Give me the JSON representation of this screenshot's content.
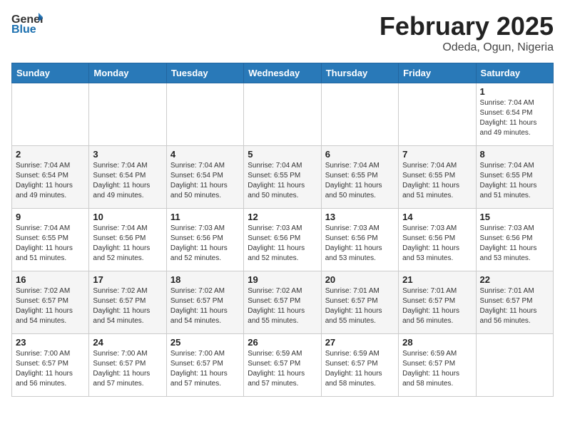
{
  "header": {
    "logo_general": "General",
    "logo_blue": "Blue",
    "title": "February 2025",
    "subtitle": "Odeda, Ogun, Nigeria"
  },
  "calendar": {
    "days_of_week": [
      "Sunday",
      "Monday",
      "Tuesday",
      "Wednesday",
      "Thursday",
      "Friday",
      "Saturday"
    ],
    "weeks": [
      [
        {
          "day": "",
          "info": ""
        },
        {
          "day": "",
          "info": ""
        },
        {
          "day": "",
          "info": ""
        },
        {
          "day": "",
          "info": ""
        },
        {
          "day": "",
          "info": ""
        },
        {
          "day": "",
          "info": ""
        },
        {
          "day": "1",
          "info": "Sunrise: 7:04 AM\nSunset: 6:54 PM\nDaylight: 11 hours\nand 49 minutes."
        }
      ],
      [
        {
          "day": "2",
          "info": "Sunrise: 7:04 AM\nSunset: 6:54 PM\nDaylight: 11 hours\nand 49 minutes."
        },
        {
          "day": "3",
          "info": "Sunrise: 7:04 AM\nSunset: 6:54 PM\nDaylight: 11 hours\nand 49 minutes."
        },
        {
          "day": "4",
          "info": "Sunrise: 7:04 AM\nSunset: 6:54 PM\nDaylight: 11 hours\nand 50 minutes."
        },
        {
          "day": "5",
          "info": "Sunrise: 7:04 AM\nSunset: 6:55 PM\nDaylight: 11 hours\nand 50 minutes."
        },
        {
          "day": "6",
          "info": "Sunrise: 7:04 AM\nSunset: 6:55 PM\nDaylight: 11 hours\nand 50 minutes."
        },
        {
          "day": "7",
          "info": "Sunrise: 7:04 AM\nSunset: 6:55 PM\nDaylight: 11 hours\nand 51 minutes."
        },
        {
          "day": "8",
          "info": "Sunrise: 7:04 AM\nSunset: 6:55 PM\nDaylight: 11 hours\nand 51 minutes."
        }
      ],
      [
        {
          "day": "9",
          "info": "Sunrise: 7:04 AM\nSunset: 6:55 PM\nDaylight: 11 hours\nand 51 minutes."
        },
        {
          "day": "10",
          "info": "Sunrise: 7:04 AM\nSunset: 6:56 PM\nDaylight: 11 hours\nand 52 minutes."
        },
        {
          "day": "11",
          "info": "Sunrise: 7:03 AM\nSunset: 6:56 PM\nDaylight: 11 hours\nand 52 minutes."
        },
        {
          "day": "12",
          "info": "Sunrise: 7:03 AM\nSunset: 6:56 PM\nDaylight: 11 hours\nand 52 minutes."
        },
        {
          "day": "13",
          "info": "Sunrise: 7:03 AM\nSunset: 6:56 PM\nDaylight: 11 hours\nand 53 minutes."
        },
        {
          "day": "14",
          "info": "Sunrise: 7:03 AM\nSunset: 6:56 PM\nDaylight: 11 hours\nand 53 minutes."
        },
        {
          "day": "15",
          "info": "Sunrise: 7:03 AM\nSunset: 6:56 PM\nDaylight: 11 hours\nand 53 minutes."
        }
      ],
      [
        {
          "day": "16",
          "info": "Sunrise: 7:02 AM\nSunset: 6:57 PM\nDaylight: 11 hours\nand 54 minutes."
        },
        {
          "day": "17",
          "info": "Sunrise: 7:02 AM\nSunset: 6:57 PM\nDaylight: 11 hours\nand 54 minutes."
        },
        {
          "day": "18",
          "info": "Sunrise: 7:02 AM\nSunset: 6:57 PM\nDaylight: 11 hours\nand 54 minutes."
        },
        {
          "day": "19",
          "info": "Sunrise: 7:02 AM\nSunset: 6:57 PM\nDaylight: 11 hours\nand 55 minutes."
        },
        {
          "day": "20",
          "info": "Sunrise: 7:01 AM\nSunset: 6:57 PM\nDaylight: 11 hours\nand 55 minutes."
        },
        {
          "day": "21",
          "info": "Sunrise: 7:01 AM\nSunset: 6:57 PM\nDaylight: 11 hours\nand 56 minutes."
        },
        {
          "day": "22",
          "info": "Sunrise: 7:01 AM\nSunset: 6:57 PM\nDaylight: 11 hours\nand 56 minutes."
        }
      ],
      [
        {
          "day": "23",
          "info": "Sunrise: 7:00 AM\nSunset: 6:57 PM\nDaylight: 11 hours\nand 56 minutes."
        },
        {
          "day": "24",
          "info": "Sunrise: 7:00 AM\nSunset: 6:57 PM\nDaylight: 11 hours\nand 57 minutes."
        },
        {
          "day": "25",
          "info": "Sunrise: 7:00 AM\nSunset: 6:57 PM\nDaylight: 11 hours\nand 57 minutes."
        },
        {
          "day": "26",
          "info": "Sunrise: 6:59 AM\nSunset: 6:57 PM\nDaylight: 11 hours\nand 57 minutes."
        },
        {
          "day": "27",
          "info": "Sunrise: 6:59 AM\nSunset: 6:57 PM\nDaylight: 11 hours\nand 58 minutes."
        },
        {
          "day": "28",
          "info": "Sunrise: 6:59 AM\nSunset: 6:57 PM\nDaylight: 11 hours\nand 58 minutes."
        },
        {
          "day": "",
          "info": ""
        }
      ]
    ]
  }
}
